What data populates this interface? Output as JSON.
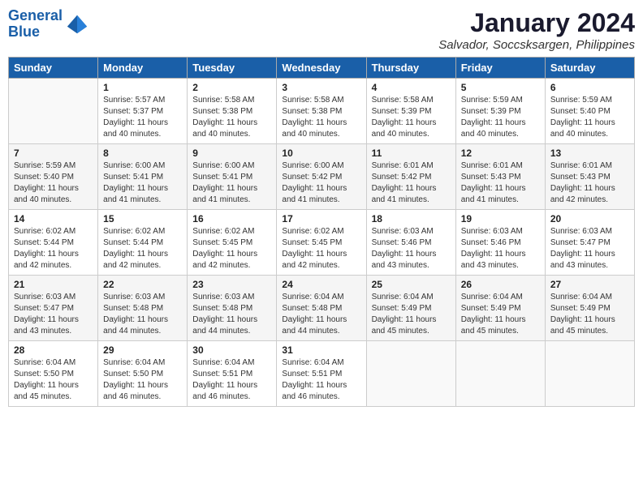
{
  "app": {
    "logo_line1": "General",
    "logo_line2": "Blue",
    "main_title": "January 2024",
    "subtitle": "Salvador, Soccsksargen, Philippines"
  },
  "calendar": {
    "headers": [
      "Sunday",
      "Monday",
      "Tuesday",
      "Wednesday",
      "Thursday",
      "Friday",
      "Saturday"
    ],
    "weeks": [
      [
        {
          "day": "",
          "info": ""
        },
        {
          "day": "1",
          "info": "Sunrise: 5:57 AM\nSunset: 5:37 PM\nDaylight: 11 hours\nand 40 minutes."
        },
        {
          "day": "2",
          "info": "Sunrise: 5:58 AM\nSunset: 5:38 PM\nDaylight: 11 hours\nand 40 minutes."
        },
        {
          "day": "3",
          "info": "Sunrise: 5:58 AM\nSunset: 5:38 PM\nDaylight: 11 hours\nand 40 minutes."
        },
        {
          "day": "4",
          "info": "Sunrise: 5:58 AM\nSunset: 5:39 PM\nDaylight: 11 hours\nand 40 minutes."
        },
        {
          "day": "5",
          "info": "Sunrise: 5:59 AM\nSunset: 5:39 PM\nDaylight: 11 hours\nand 40 minutes."
        },
        {
          "day": "6",
          "info": "Sunrise: 5:59 AM\nSunset: 5:40 PM\nDaylight: 11 hours\nand 40 minutes."
        }
      ],
      [
        {
          "day": "7",
          "info": "Sunrise: 5:59 AM\nSunset: 5:40 PM\nDaylight: 11 hours\nand 40 minutes."
        },
        {
          "day": "8",
          "info": "Sunrise: 6:00 AM\nSunset: 5:41 PM\nDaylight: 11 hours\nand 41 minutes."
        },
        {
          "day": "9",
          "info": "Sunrise: 6:00 AM\nSunset: 5:41 PM\nDaylight: 11 hours\nand 41 minutes."
        },
        {
          "day": "10",
          "info": "Sunrise: 6:00 AM\nSunset: 5:42 PM\nDaylight: 11 hours\nand 41 minutes."
        },
        {
          "day": "11",
          "info": "Sunrise: 6:01 AM\nSunset: 5:42 PM\nDaylight: 11 hours\nand 41 minutes."
        },
        {
          "day": "12",
          "info": "Sunrise: 6:01 AM\nSunset: 5:43 PM\nDaylight: 11 hours\nand 41 minutes."
        },
        {
          "day": "13",
          "info": "Sunrise: 6:01 AM\nSunset: 5:43 PM\nDaylight: 11 hours\nand 42 minutes."
        }
      ],
      [
        {
          "day": "14",
          "info": "Sunrise: 6:02 AM\nSunset: 5:44 PM\nDaylight: 11 hours\nand 42 minutes."
        },
        {
          "day": "15",
          "info": "Sunrise: 6:02 AM\nSunset: 5:44 PM\nDaylight: 11 hours\nand 42 minutes."
        },
        {
          "day": "16",
          "info": "Sunrise: 6:02 AM\nSunset: 5:45 PM\nDaylight: 11 hours\nand 42 minutes."
        },
        {
          "day": "17",
          "info": "Sunrise: 6:02 AM\nSunset: 5:45 PM\nDaylight: 11 hours\nand 42 minutes."
        },
        {
          "day": "18",
          "info": "Sunrise: 6:03 AM\nSunset: 5:46 PM\nDaylight: 11 hours\nand 43 minutes."
        },
        {
          "day": "19",
          "info": "Sunrise: 6:03 AM\nSunset: 5:46 PM\nDaylight: 11 hours\nand 43 minutes."
        },
        {
          "day": "20",
          "info": "Sunrise: 6:03 AM\nSunset: 5:47 PM\nDaylight: 11 hours\nand 43 minutes."
        }
      ],
      [
        {
          "day": "21",
          "info": "Sunrise: 6:03 AM\nSunset: 5:47 PM\nDaylight: 11 hours\nand 43 minutes."
        },
        {
          "day": "22",
          "info": "Sunrise: 6:03 AM\nSunset: 5:48 PM\nDaylight: 11 hours\nand 44 minutes."
        },
        {
          "day": "23",
          "info": "Sunrise: 6:03 AM\nSunset: 5:48 PM\nDaylight: 11 hours\nand 44 minutes."
        },
        {
          "day": "24",
          "info": "Sunrise: 6:04 AM\nSunset: 5:48 PM\nDaylight: 11 hours\nand 44 minutes."
        },
        {
          "day": "25",
          "info": "Sunrise: 6:04 AM\nSunset: 5:49 PM\nDaylight: 11 hours\nand 45 minutes."
        },
        {
          "day": "26",
          "info": "Sunrise: 6:04 AM\nSunset: 5:49 PM\nDaylight: 11 hours\nand 45 minutes."
        },
        {
          "day": "27",
          "info": "Sunrise: 6:04 AM\nSunset: 5:49 PM\nDaylight: 11 hours\nand 45 minutes."
        }
      ],
      [
        {
          "day": "28",
          "info": "Sunrise: 6:04 AM\nSunset: 5:50 PM\nDaylight: 11 hours\nand 45 minutes."
        },
        {
          "day": "29",
          "info": "Sunrise: 6:04 AM\nSunset: 5:50 PM\nDaylight: 11 hours\nand 46 minutes."
        },
        {
          "day": "30",
          "info": "Sunrise: 6:04 AM\nSunset: 5:51 PM\nDaylight: 11 hours\nand 46 minutes."
        },
        {
          "day": "31",
          "info": "Sunrise: 6:04 AM\nSunset: 5:51 PM\nDaylight: 11 hours\nand 46 minutes."
        },
        {
          "day": "",
          "info": ""
        },
        {
          "day": "",
          "info": ""
        },
        {
          "day": "",
          "info": ""
        }
      ]
    ]
  }
}
